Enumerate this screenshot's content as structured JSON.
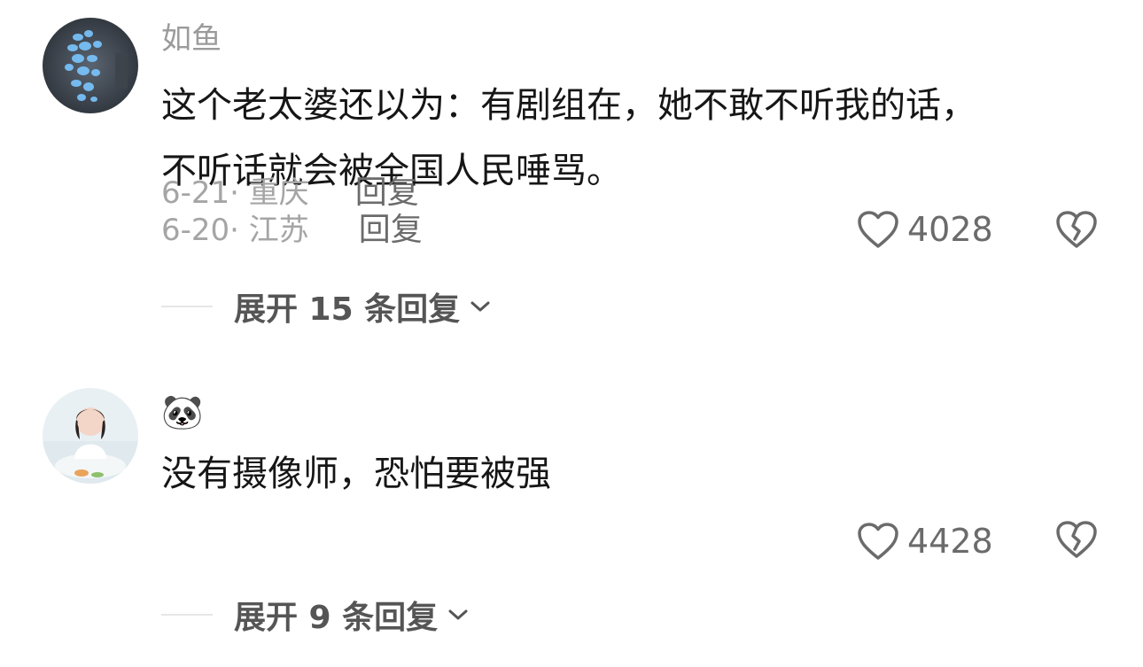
{
  "comments": [
    {
      "username": "如鱼",
      "avatar": "butterfly-wall-avatar",
      "lines": [
        "这个老太婆还以为：有剧组在，她不敢不听我的话，",
        "不听话就会被全国人民唾骂。"
      ],
      "date_location": "6-20· 江苏",
      "reply_label": "回复",
      "like_count": "4028",
      "expand_label": "展开 15 条回复"
    },
    {
      "username": "🐼",
      "avatar": "girl-photo-avatar",
      "lines": [
        "没有摄像师，恐怕要被强"
      ],
      "date_location": "6-21· 重庆",
      "reply_label": "回复",
      "like_count": "4428",
      "expand_label": "展开 9 条回复"
    }
  ],
  "colors": {
    "username": "#9b9b9b",
    "text": "#161616",
    "meta": "#a5a5a5",
    "action": "#6b6b6b"
  },
  "icons": {
    "like": "heart-outline-icon",
    "dislike": "broken-heart-icon",
    "expand": "chevron-down-icon"
  }
}
